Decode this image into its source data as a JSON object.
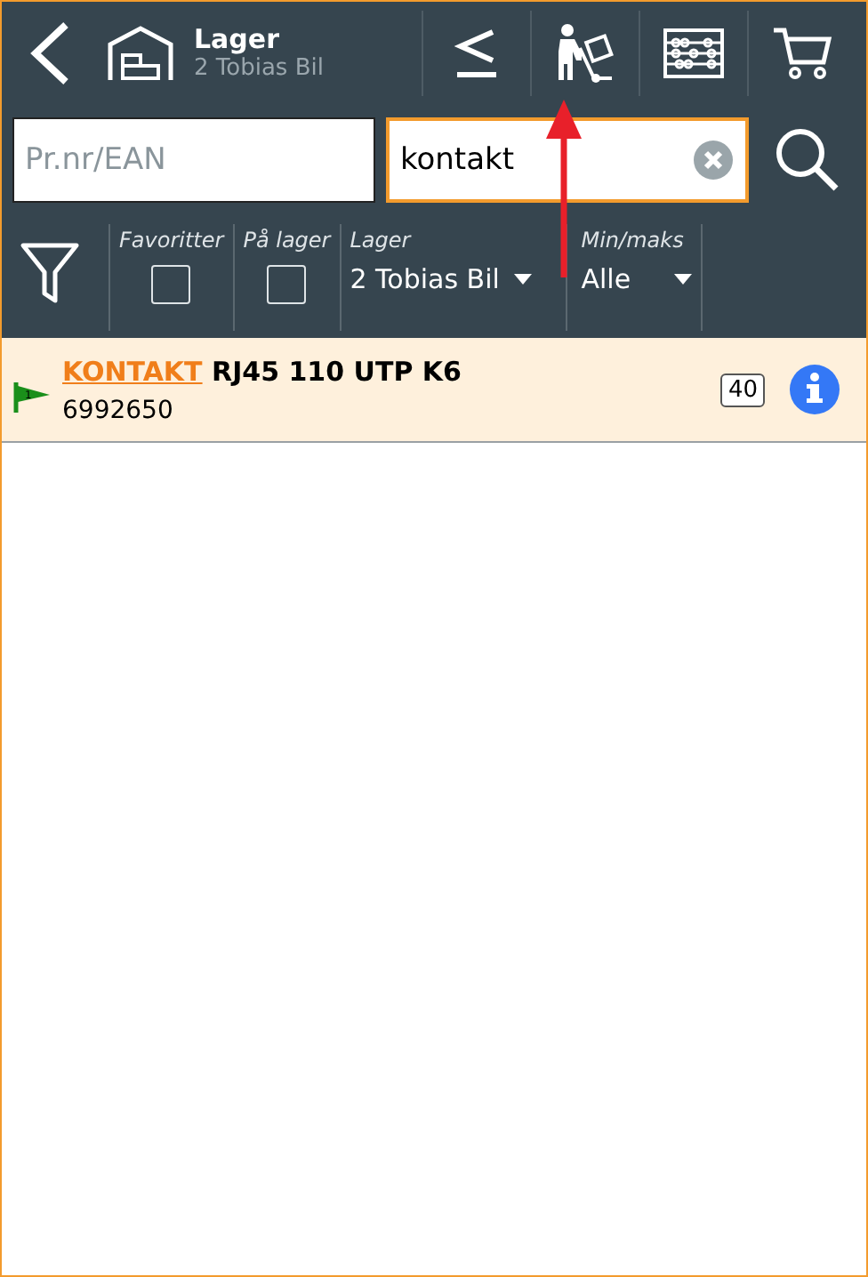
{
  "header": {
    "title": "Lager",
    "subtitle": "2 Tobias Bil"
  },
  "search": {
    "product_field": {
      "placeholder": "Pr.nr/EAN"
    },
    "text_field": {
      "value": "kontakt",
      "focused": true
    }
  },
  "filters": [
    {
      "kind": "checkbox",
      "label": "Favoritter",
      "checked": false
    },
    {
      "kind": "checkbox",
      "label": "På lager",
      "checked": false
    },
    {
      "kind": "select",
      "label": "Lager",
      "value": "2 Tobias Bil"
    },
    {
      "kind": "select",
      "label": "Min/maks",
      "value": "Alle"
    }
  ],
  "products": [
    {
      "match": "KONTAKT",
      "rest": "RJ45 110 UTP K6",
      "number": "6992650",
      "flag_label": "1",
      "count": "40"
    }
  ],
  "annotation": {
    "kind": "arrow"
  }
}
